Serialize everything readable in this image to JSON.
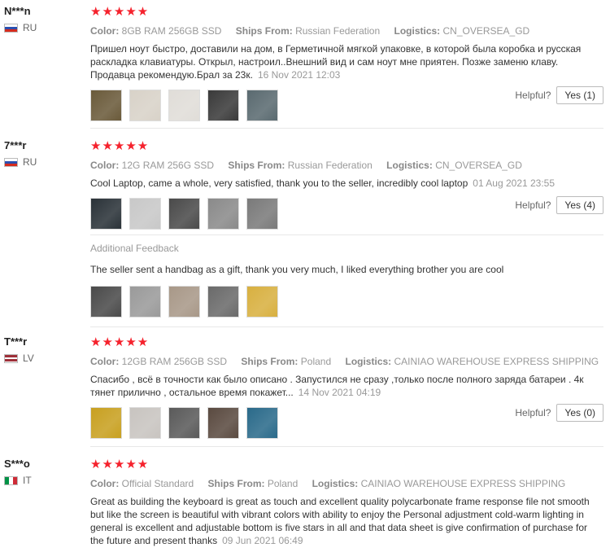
{
  "labels": {
    "color": "Color:",
    "ships_from": "Ships From:",
    "logistics": "Logistics:",
    "helpful": "Helpful?",
    "additional": "Additional Feedback"
  },
  "rating_stars": "★★★★★",
  "reviews": [
    {
      "user": "N***n",
      "country": "RU",
      "color": "8GB RAM 256GB SSD",
      "ships_from": "Russian Federation",
      "logistics": "CN_OVERSEA_GD",
      "text": "Пришел ноут быстро, доставили на дом, в Герметичной мягкой упаковке, в которой была коробка и русская раскладка клавиатуры. Открыл, настроил..Внешний вид и сам ноут мне приятен. Позже заменю клаву. Продавца рекомендую.Брал за 23к.",
      "date": "16 Nov 2021 12:03",
      "helpful": "Yes (1)",
      "thumb_colors": [
        "#6a5a3a",
        "#d8d2c8",
        "#e0ddd8",
        "#3a3a3a",
        "#5a6a70"
      ]
    },
    {
      "user": "7***r",
      "country": "RU",
      "color": "12G RAM 256G SSD",
      "ships_from": "Russian Federation",
      "logistics": "CN_OVERSEA_GD",
      "text": "Cool Laptop, came a whole, very satisfied, thank you to the seller, incredibly cool laptop",
      "date": "01 Aug 2021 23:55",
      "helpful": "Yes (4)",
      "thumb_colors": [
        "#2a3238",
        "#c8c8c8",
        "#4a4a4a",
        "#8a8a8a",
        "#7a7a7a"
      ],
      "additional_text": "The seller sent a handbag as a gift, thank you very much, I liked everything brother you are cool",
      "additional_thumb_colors": [
        "#4a4a4a",
        "#9a9a9a",
        "#a89888",
        "#6a6a6a",
        "#d8b040"
      ]
    },
    {
      "user": "T***r",
      "country": "LV",
      "color": "12GB RAM 256GB SSD",
      "ships_from": "Poland",
      "logistics": "CAINIAO WAREHOUSE EXPRESS SHIPPING",
      "text": "Спасибо , всё в точности как было описано . Запустился не сразу ,только после полного заряда батареи . 4к тянет прилично , остальное время покажет...",
      "date": "14 Nov 2021 04:19",
      "helpful": "Yes (0)",
      "thumb_colors": [
        "#c8a020",
        "#c8c4c0",
        "#5a5a5a",
        "#5a4a40",
        "#2a6a8a"
      ]
    },
    {
      "user": "S***o",
      "country": "IT",
      "color": "Official Standard",
      "ships_from": "Poland",
      "logistics": "CAINIAO WAREHOUSE EXPRESS SHIPPING",
      "text": "Great as building the keyboard is great as touch and excellent quality polycarbonate frame response file not smooth but like the screen is beautiful with vibrant colors with ability to enjoy the Personal adjustment cold-warm lighting in general is excellent and adjustable bottom is five stars in all and that data sheet is give confirmation of purchase for the future and present thanks",
      "date": "09 Jun 2021 06:49"
    }
  ]
}
